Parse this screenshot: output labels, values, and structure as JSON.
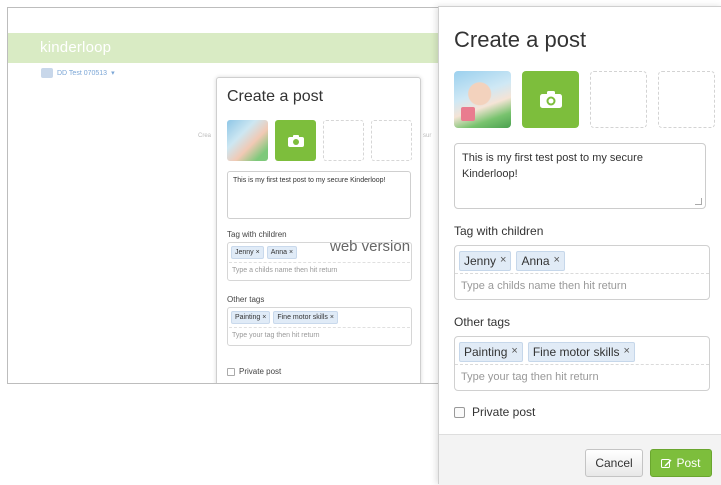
{
  "background_window": {
    "logo": "kinderloop",
    "account": "DD Test 070513",
    "faint_left": "Crea",
    "faint_right": "sur",
    "modal": {
      "title": "Create a post",
      "post_text": "This is my first test post to my secure Kinderloop!",
      "tag_children_label": "Tag with children",
      "children_tags": [
        "Jenny ×",
        "Anna ×"
      ],
      "children_placeholder": "Type a childs name then hit return",
      "other_tags_label": "Other tags",
      "other_tags": [
        "Painting ×",
        "Fine motor skills ×"
      ],
      "other_placeholder": "Type your tag then hit return",
      "private_label": "Private post"
    }
  },
  "caption": "web version",
  "modal": {
    "title": "Create a post",
    "post_text": "This is my first test post to my secure Kinderloop!",
    "tag_children_label": "Tag with children",
    "children_tags": [
      {
        "name": "Jenny",
        "remove": "×"
      },
      {
        "name": "Anna",
        "remove": "×"
      }
    ],
    "children_placeholder": "Type a childs name then hit return",
    "other_tags_label": "Other tags",
    "other_tags": [
      {
        "name": "Painting",
        "remove": "×"
      },
      {
        "name": "Fine motor skills",
        "remove": "×"
      }
    ],
    "other_placeholder": "Type your tag then hit return",
    "private_label": "Private post",
    "cancel_label": "Cancel",
    "post_label": "Post",
    "accent_color": "#7dbe3c"
  }
}
